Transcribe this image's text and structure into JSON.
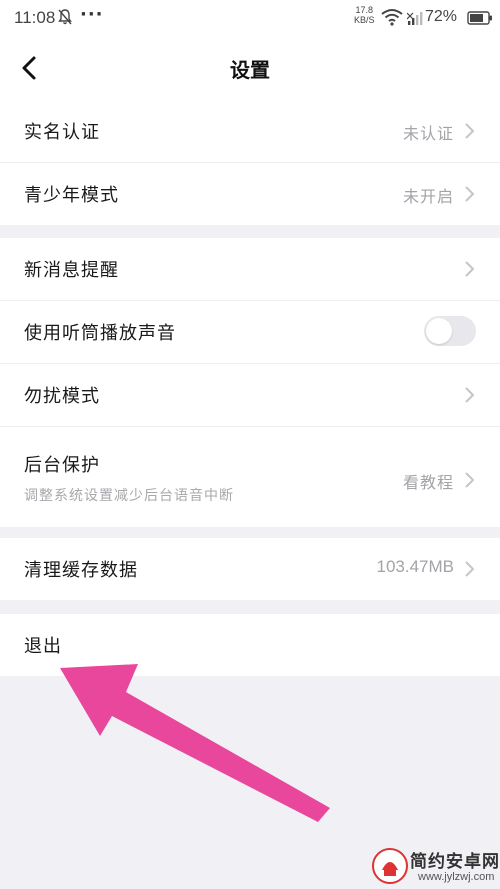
{
  "status_bar": {
    "time": "11:08",
    "overflow_dots": "···",
    "net_speed_value": "17.8",
    "net_speed_unit": "KB/S",
    "battery_percent": "72%"
  },
  "header": {
    "title": "设置"
  },
  "groups": [
    {
      "rows": [
        {
          "label": "实名认证",
          "value": "未认证",
          "control": "chevron"
        },
        {
          "label": "青少年模式",
          "value": "未开启",
          "control": "chevron"
        }
      ]
    },
    {
      "rows": [
        {
          "label": "新消息提醒",
          "value": "",
          "control": "chevron"
        },
        {
          "label": "使用听筒播放声音",
          "control": "toggle",
          "toggle_on": false
        },
        {
          "label": "勿扰模式",
          "value": "",
          "control": "chevron"
        },
        {
          "label": "后台保护",
          "sublabel": "调整系统设置减少后台语音中断",
          "value": "看教程",
          "control": "chevron"
        }
      ]
    },
    {
      "rows": [
        {
          "label": "清理缓存数据",
          "value": "103.47MB",
          "control": "chevron"
        }
      ]
    },
    {
      "rows": [
        {
          "label": "退出"
        }
      ]
    }
  ],
  "annotation": {
    "arrow_color": "#e9479c"
  },
  "watermark": {
    "text": "简约安卓网",
    "url": "www.jylzwj.com"
  }
}
